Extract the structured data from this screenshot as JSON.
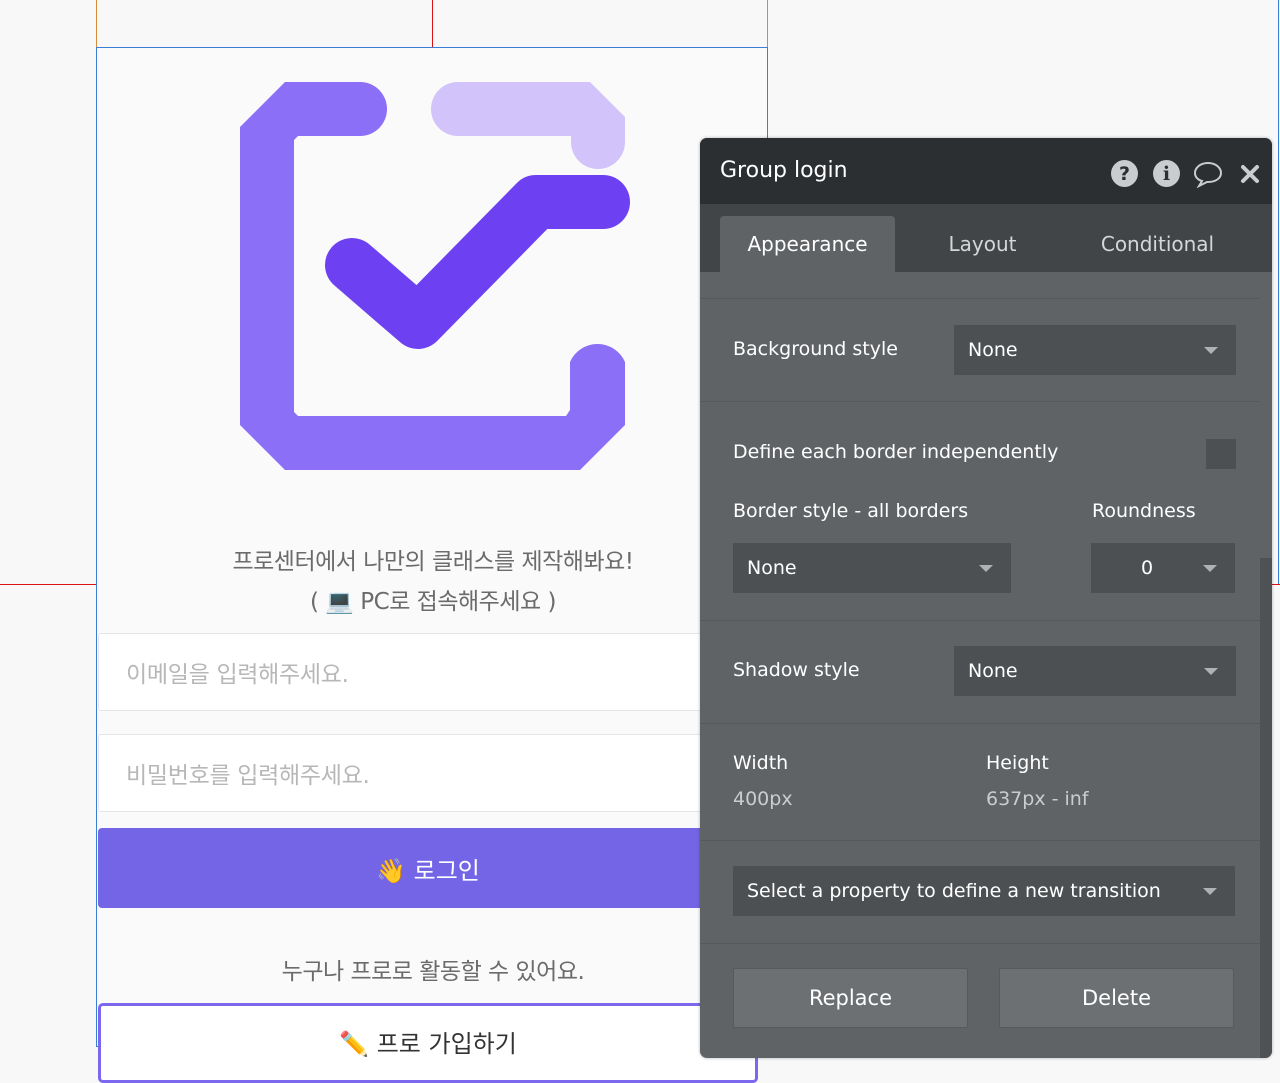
{
  "canvas": {
    "tagline_line1": "프로센터에서 나만의 클래스를 제작해봐요!",
    "tagline_line2": "( 💻 PC로 접속해주세요 )",
    "email": {
      "placeholder": "이메일을 입력해주세요."
    },
    "password": {
      "placeholder": "비밀번호를 입력해주세요."
    },
    "login_button": "👋 로그인",
    "signup_prompt": "누구나 프로로 활동할 수 있어요.",
    "signup_button": "✏️ 프로 가입하기",
    "logo_colors": {
      "frame": "#8b6ff6",
      "corner": "#d2c4fb",
      "check": "#6d41f2"
    }
  },
  "panel": {
    "title": "Group login",
    "header_icons": [
      "help-icon",
      "info-icon",
      "comment-icon",
      "close-icon"
    ],
    "tabs": [
      "Appearance",
      "Layout",
      "Conditional"
    ],
    "active_tab": "Appearance",
    "background_style": {
      "label": "Background style",
      "value": "None"
    },
    "define_borders": {
      "label": "Define each border independently",
      "checked": false
    },
    "border_style": {
      "label": "Border style - all borders",
      "value": "None"
    },
    "roundness": {
      "label": "Roundness",
      "value": "0"
    },
    "shadow_style": {
      "label": "Shadow style",
      "value": "None"
    },
    "width": {
      "label": "Width",
      "value": "400px"
    },
    "height": {
      "label": "Height",
      "value": "637px - inf"
    },
    "transition": {
      "value": "Select a property to define a new transition"
    },
    "replace_button": "Replace",
    "delete_button": "Delete"
  },
  "colors": {
    "accent": "#7465e7",
    "panel_bg": "#5f6366",
    "panel_header": "#2b2f32"
  }
}
